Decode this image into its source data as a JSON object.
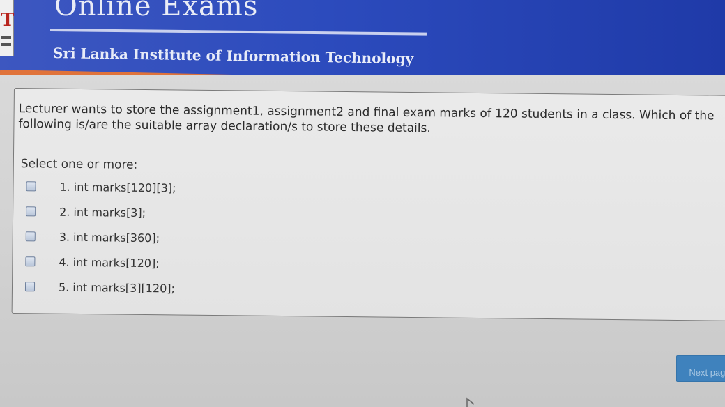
{
  "header": {
    "title": "Online Exams",
    "subtitle": "Sri Lanka Institute of Information Technology",
    "logo_text": "T"
  },
  "question": {
    "text": "Lecturer wants to store the assignment1, assignment2 and final exam marks of 120 students in a class. Which of the following is/are the suitable array declaration/s to store these details.",
    "prompt": "Select one or more:",
    "options": [
      {
        "label": "1. int marks[120][3];",
        "checked": false
      },
      {
        "label": "2. int marks[3];",
        "checked": false
      },
      {
        "label": "3. int marks[360];",
        "checked": false
      },
      {
        "label": "4. int marks[120];",
        "checked": false
      },
      {
        "label": "5. int marks[3][120];",
        "checked": false
      }
    ]
  },
  "navigation": {
    "next_label": "Next page"
  },
  "colors": {
    "header_blue": "#2c4bbd",
    "accent_orange": "#e0733a",
    "button_blue": "#3f82bd"
  }
}
